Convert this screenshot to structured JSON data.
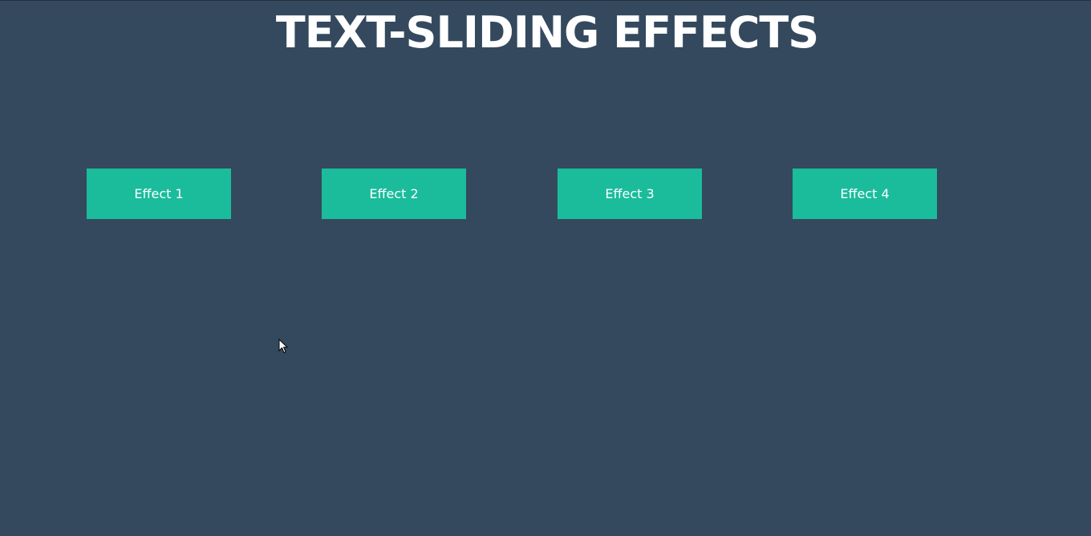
{
  "colors": {
    "background": "#34495e",
    "button_background": "#1abc9c",
    "text": "#ffffff"
  },
  "page": {
    "title": "TEXT-SLIDING EFFECTS"
  },
  "effects": [
    {
      "label": "Effect 1"
    },
    {
      "label": "Effect 2"
    },
    {
      "label": "Effect 3"
    },
    {
      "label": "Effect 4"
    }
  ],
  "cursor": {
    "icon": "arrow-pointer-icon"
  }
}
